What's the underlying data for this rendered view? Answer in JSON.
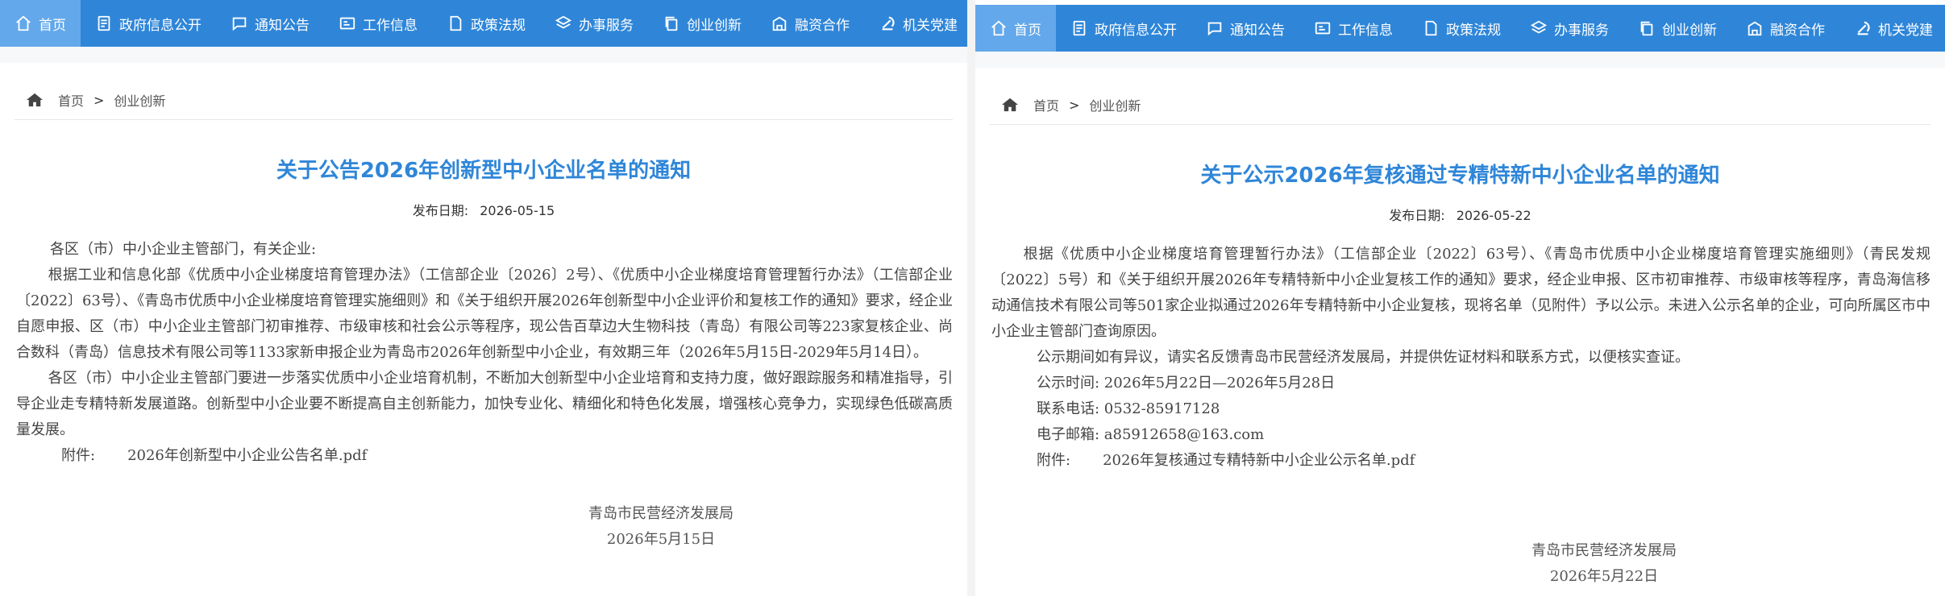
{
  "nav": {
    "items": [
      {
        "label": "首页",
        "icon": "home-icon"
      },
      {
        "label": "政府信息公开",
        "icon": "document-icon"
      },
      {
        "label": "通知公告",
        "icon": "chat-icon"
      },
      {
        "label": "工作信息",
        "icon": "card-icon"
      },
      {
        "label": "政策法规",
        "icon": "file-icon"
      },
      {
        "label": "办事服务",
        "icon": "layers-icon"
      },
      {
        "label": "创业创新",
        "icon": "copy-icon"
      },
      {
        "label": "融资合作",
        "icon": "building-icon"
      },
      {
        "label": "机关党建",
        "icon": "party-icon"
      }
    ],
    "colors": {
      "bar": "#2f86d8",
      "active": "#63a8ea"
    }
  },
  "left": {
    "breadcrumb": {
      "home": "首页",
      "separator": ">",
      "current": "创业创新"
    },
    "title": "关于公告2026年创新型中小企业名单的通知",
    "date_label": "发布日期:",
    "date_value": "2026-05-15",
    "salutation": "各区（市）中小企业主管部门，有关企业:",
    "paragraphs": [
      "根据工业和信息化部《优质中小企业梯度培育管理办法》（工信部企业〔2026〕2号）、《优质中小企业梯度培育管理暂行办法》（工信部企业〔2022〕63号）、《青岛市优质中小企业梯度培育管理实施细则》和《关于组织开展2026年创新型中小企业评价和复核工作的通知》要求，经企业自愿申报、区（市）中小企业主管部门初审推荐、市级审核和社会公示等程序，现公告百草边大生物科技（青岛）有限公司等223家复核企业、尚合数科（青岛）信息技术有限公司等1133家新申报企业为青岛市2026年创新型中小企业，有效期三年（2026年5月15日-2029年5月14日）。",
      "各区（市）中小企业主管部门要进一步落实优质中小企业培育机制，不断加大创新型中小企业培育和支持力度，做好跟踪服务和精准指导，引导企业走专精特新发展道路。创新型中小企业要不断提高自主创新能力，加快专业化、精细化和特色化发展，增强核心竞争力，实现绿色低碳高质量发展。"
    ],
    "attachment_label": "附件:",
    "attachment_file": "2026年创新型中小企业公告名单.pdf",
    "signature_org": "青岛市民营经济发展局",
    "signature_date": "2026年5月15日"
  },
  "right": {
    "breadcrumb": {
      "home": "首页",
      "separator": ">",
      "current": "创业创新"
    },
    "title": "关于公示2026年复核通过专精特新中小企业名单的通知",
    "date_label": "发布日期:",
    "date_value": "2026-05-22",
    "paragraphs": [
      "根据《优质中小企业梯度培育管理暂行办法》（工信部企业〔2022〕63号）、《青岛市优质中小企业梯度培育管理实施细则》（青民发规〔2022〕5号）和《关于组织开展2026年专精特新中小企业复核工作的通知》要求，经企业申报、区市初审推荐、市级审核等程序，青岛海信移动通信技术有限公司等501家企业拟通过2026年专精特新中小企业复核，现将名单（见附件）予以公示。未进入公示名单的企业，可向所属区市中小企业主管部门查询原因。",
      "公示期间如有异议，请实名反馈青岛市民营经济发展局，并提供佐证材料和联系方式，以便核实查证。"
    ],
    "period": "公示时间: 2026年5月22日—2026年5月28日",
    "phone": "联系电话: 0532-85917128",
    "email": "电子邮箱: a85912658@163.com",
    "attachment_label": "附件:",
    "attachment_file": "2026年复核通过专精特新中小企业公示名单.pdf",
    "signature_org": "青岛市民营经济发展局",
    "signature_date": "2026年5月22日"
  }
}
